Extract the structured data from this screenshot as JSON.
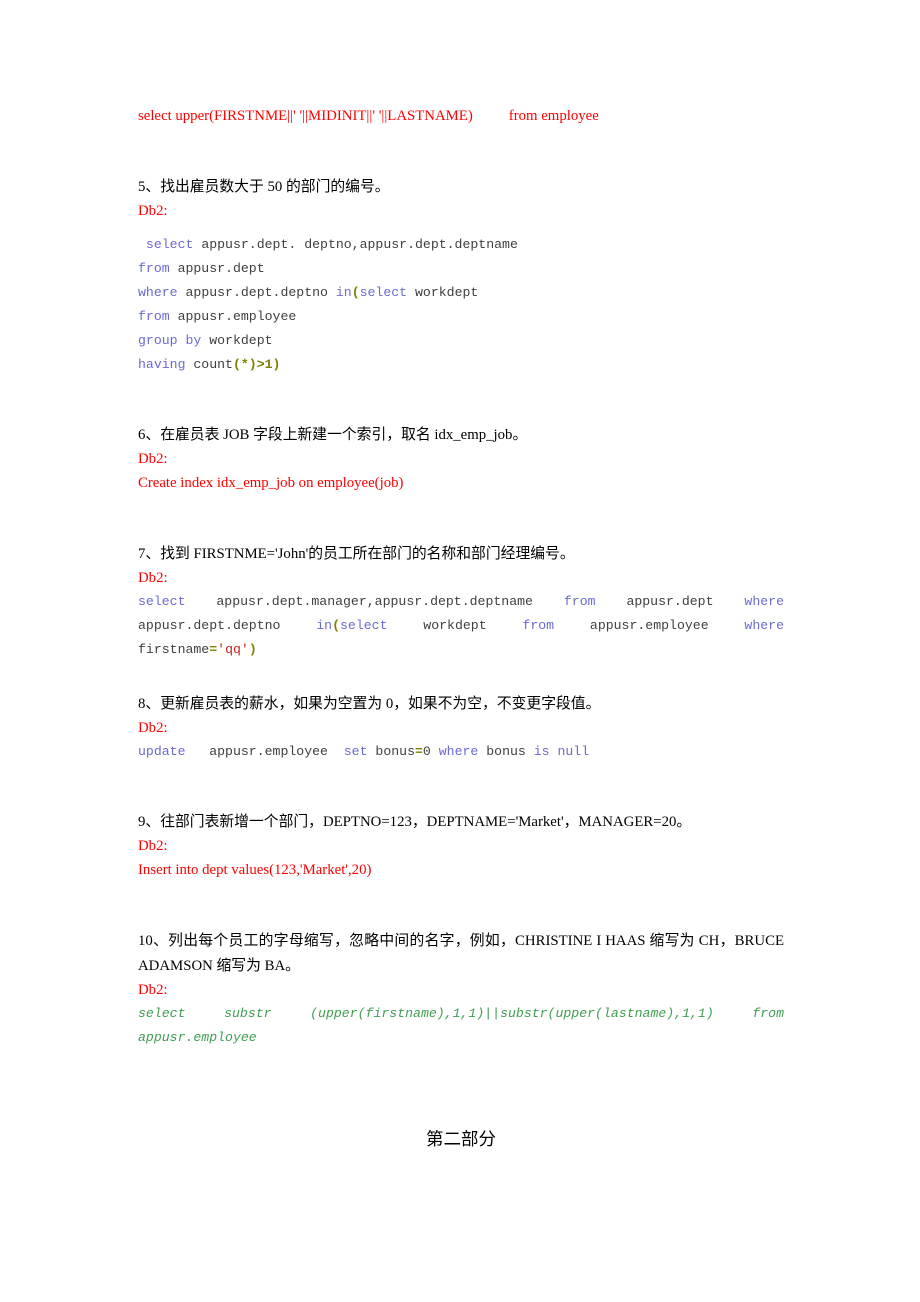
{
  "document": {
    "top_answer": {
      "text": "select upper(FIRSTNME||' '||MIDINIT||' '||LASTNAME)",
      "tail": "from employee"
    },
    "items": [
      {
        "number": "5",
        "question": "5、找出雇员数大于 50 的部门的编号。",
        "label": "Db2:",
        "code_lines": [
          " select appusr.dept. deptno,appusr.dept.deptname",
          "from appusr.dept",
          "where appusr.dept.deptno in(select workdept",
          "from appusr.employee",
          "group by workdept",
          "having count(*)>1)"
        ]
      },
      {
        "number": "6",
        "question": "6、在雇员表 JOB 字段上新建一个索引，取名 idx_emp_job。",
        "label": "Db2:",
        "answer": "Create index idx_emp_job on employee(job)"
      },
      {
        "number": "7",
        "question": "7、找到 FIRSTNME='John'的员工所在部门的名称和部门经理编号。",
        "label": "Db2:",
        "code": "select appusr.dept.manager,appusr.dept.deptname from appusr.dept where appusr.dept.deptno  in(select  workdept  from  appusr.employee  where firstname='qq')"
      },
      {
        "number": "8",
        "question": "8、更新雇员表的薪水，如果为空置为 0，如果不为空，不变更字段值。",
        "label": "Db2:",
        "code": "update   appusr.employee  set bonus=0 where bonus is null"
      },
      {
        "number": "9",
        "question": "9、往部门表新增一个部门，DEPTNO=123，DEPTNAME='Market'，MANAGER=20。",
        "label": "Db2:",
        "answer": "Insert into dept values(123,'Market',20)"
      },
      {
        "number": "10",
        "question": "10、列出每个员工的字母缩写，忽略中间的名字，例如，CHRISTINE I HAAS 缩写为 CH，BRUCE ADAMSON 缩写为 BA。",
        "label": "Db2:",
        "code": "select substr (upper(firstname),1,1)||substr(upper(lastname),1,1) from appusr.employee"
      }
    ],
    "footer": {
      "part_title": "第二部分"
    },
    "colors": {
      "red": "#ff0000",
      "keyword_blue": "#6a6ad4",
      "identifier_gray": "#404040",
      "operator_olive": "#808000",
      "string_red": "#cc2020",
      "green_italic": "#3f9e51",
      "text_black": "#000000"
    }
  }
}
